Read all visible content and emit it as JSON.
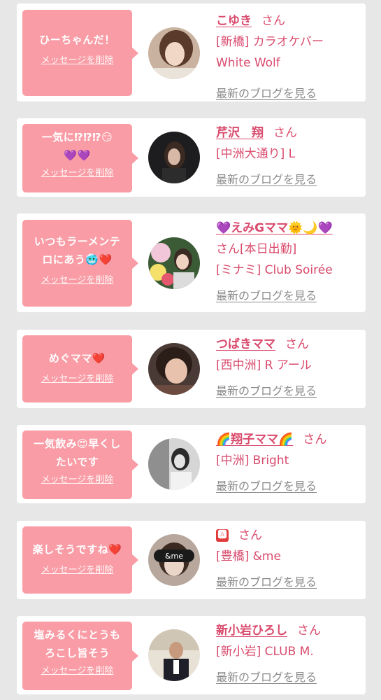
{
  "san_label": "さん",
  "delete_label": "メッセージを削除",
  "blog_label": "最新のブログを見る",
  "colors": {
    "bubble": "#f99ca5",
    "name": "#d94a6c",
    "link_gray": "#8a8a8a",
    "background": "#e7e7e7"
  },
  "cards": [
    {
      "message": [
        "ひーちゃんだ！"
      ],
      "name": "こゆき",
      "shop": [
        "[新橋] カラオケバー",
        "White Wolf"
      ]
    },
    {
      "message": [
        "一気に⁉⁉⁉😏",
        "💜💜"
      ],
      "name": "芹沢　翔",
      "shop": [
        "[中洲大通り] L"
      ]
    },
    {
      "message": [
        "いつもラーメンテ",
        "ロにあう🥶❤️"
      ],
      "name": "💜えみGママ🌞🌙💜",
      "shop": [
        "さん[本日出勤]",
        "[ミナミ] Club Soirée"
      ]
    },
    {
      "message": [
        "めぐママ❤️"
      ],
      "name": "つばきママ",
      "shop": [
        "[西中洲] R アール"
      ]
    },
    {
      "message": [
        "一気飲み😍早くし",
        "たいです"
      ],
      "name": "🌈翔子ママ🌈",
      "shop": [
        "[中洲] Bright"
      ]
    },
    {
      "message": [
        "楽しそうですね❤️"
      ],
      "name": "🅰",
      "shop": [
        "[豊橋] &me"
      ]
    },
    {
      "message": [
        "塩みるくにとうも",
        "ろこし旨そう"
      ],
      "name": "新小岩ひろし",
      "shop": [
        "[新小岩] CLUB M."
      ]
    }
  ]
}
